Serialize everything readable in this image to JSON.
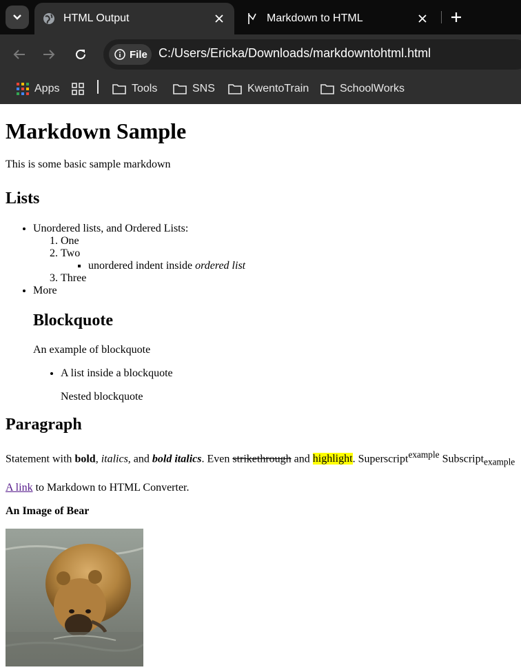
{
  "browser": {
    "tabs": [
      {
        "label": "HTML Output",
        "active": true
      },
      {
        "label": "Markdown to HTML",
        "active": false
      }
    ],
    "chip_label": "File",
    "url": "C:/Users/Ericka/Downloads/markdowntohtml.html",
    "bookmarks": [
      {
        "label": "Apps",
        "icon": "apps-grid-icon"
      },
      {
        "label": "Tools",
        "icon": "folder-icon"
      },
      {
        "label": "SNS",
        "icon": "folder-icon"
      },
      {
        "label": "KwentoTrain",
        "icon": "folder-icon"
      },
      {
        "label": "SchoolWorks",
        "icon": "folder-icon"
      }
    ]
  },
  "page": {
    "title": "Markdown Sample",
    "intro": "This is some basic sample markdown",
    "lists": {
      "heading": "Lists",
      "item1": "Unordered lists, and Ordered Lists:",
      "ordered": [
        "One",
        "Two",
        "Three"
      ],
      "nested_text": "unordered indent inside ",
      "nested_italic": "ordered list",
      "item2": "More"
    },
    "blockquote": {
      "heading": "Blockquote",
      "text": "An example of blockquote",
      "list_item": "A list inside a blockquote",
      "nested": "Nested blockquote"
    },
    "paragraph": {
      "heading": "Paragraph",
      "s1": "Statement with ",
      "bold": "bold",
      "s2": ", ",
      "italics": "italics",
      "s3": ", and ",
      "bold_italics": "bold italics",
      "s4": ". Even ",
      "strike": "strikethrough",
      "s5": " and ",
      "highlight": "highlight",
      "s6": ". Superscript",
      "sup": "example",
      "s7": " Subscript",
      "sub": "example"
    },
    "link": {
      "text": "A link",
      "rest": " to Markdown to HTML Converter."
    },
    "image_caption": "An Image of Bear"
  }
}
